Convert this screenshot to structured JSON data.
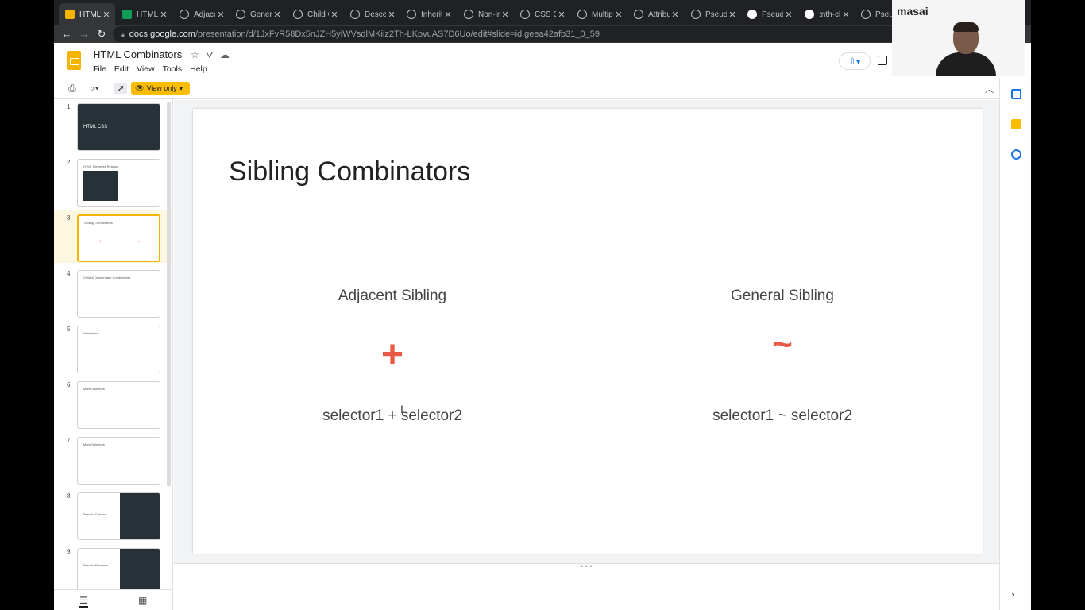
{
  "browser": {
    "tabs": [
      {
        "label": "HTML",
        "favicon": "slides-icon",
        "color": "#f4b400",
        "active": true
      },
      {
        "label": "HTML",
        "favicon": "sheets-icon",
        "color": "#0f9d58"
      },
      {
        "label": "Adjace",
        "favicon": "openai-icon",
        "color": "#bdc1c6"
      },
      {
        "label": "Genera",
        "favicon": "openai-icon",
        "color": "#bdc1c6"
      },
      {
        "label": "Child C",
        "favicon": "openai-icon",
        "color": "#bdc1c6"
      },
      {
        "label": "Descen",
        "favicon": "openai-icon",
        "color": "#bdc1c6"
      },
      {
        "label": "Inherit",
        "favicon": "openai-icon",
        "color": "#bdc1c6"
      },
      {
        "label": "Non-in",
        "favicon": "openai-icon",
        "color": "#bdc1c6"
      },
      {
        "label": "CSS Cl",
        "favicon": "openai-icon",
        "color": "#bdc1c6"
      },
      {
        "label": "Multipl",
        "favicon": "openai-icon",
        "color": "#bdc1c6"
      },
      {
        "label": "Attribu",
        "favicon": "openai-icon",
        "color": "#bdc1c6"
      },
      {
        "label": "Pseudo",
        "favicon": "openai-icon",
        "color": "#bdc1c6"
      },
      {
        "label": "Pseudo",
        "favicon": "github-icon",
        "color": "#ffffff"
      },
      {
        "label": ":nth-ch",
        "favicon": "github-icon",
        "color": "#ffffff"
      },
      {
        "label": "Pseudo",
        "favicon": "openai-icon",
        "color": "#bdc1c6"
      }
    ],
    "url_host": "docs.google.com",
    "url_path": "/presentation/d/1JxFvR58Dx5nJZH5yiWVsdlMKiiz2Th-LKpvuAS7D6Uo/edit#slide=id.geea42afb31_0_59"
  },
  "doc": {
    "title": "HTML Combinators",
    "menus": [
      "File",
      "Edit",
      "View",
      "Tools",
      "Help"
    ],
    "view_mode": "View only",
    "accent": "#f4b400"
  },
  "webcam": {
    "brand": "masai"
  },
  "filmstrip": {
    "selected": 3,
    "slides": [
      {
        "num": "1",
        "caption": "HTML CSS",
        "dark": true
      },
      {
        "num": "2",
        "caption": "HTML Elements Relation",
        "dark": false
      },
      {
        "num": "3",
        "caption": "Sibling Combinators",
        "dark": false
      },
      {
        "num": "4",
        "caption": "Child & Descendant Combinators",
        "dark": false
      },
      {
        "num": "5",
        "caption": "Inheritance",
        "dark": false
      },
      {
        "num": "6",
        "caption": "More Selectors",
        "dark": false
      },
      {
        "num": "7",
        "caption": "More Selectors",
        "dark": false
      },
      {
        "num": "8",
        "caption": "Pseudo Classes",
        "dark": false
      },
      {
        "num": "9",
        "caption": "Pseudo Elements",
        "dark": false
      }
    ]
  },
  "slide": {
    "title": "Sibling Combinators",
    "columns": [
      {
        "heading": "Adjacent Sibling",
        "symbol": "+",
        "example": "selector1 + selector2"
      },
      {
        "heading": "General Sibling",
        "symbol": "~",
        "example": "selector1 ~ selector2"
      }
    ],
    "symbol_color": "#e85a45"
  }
}
